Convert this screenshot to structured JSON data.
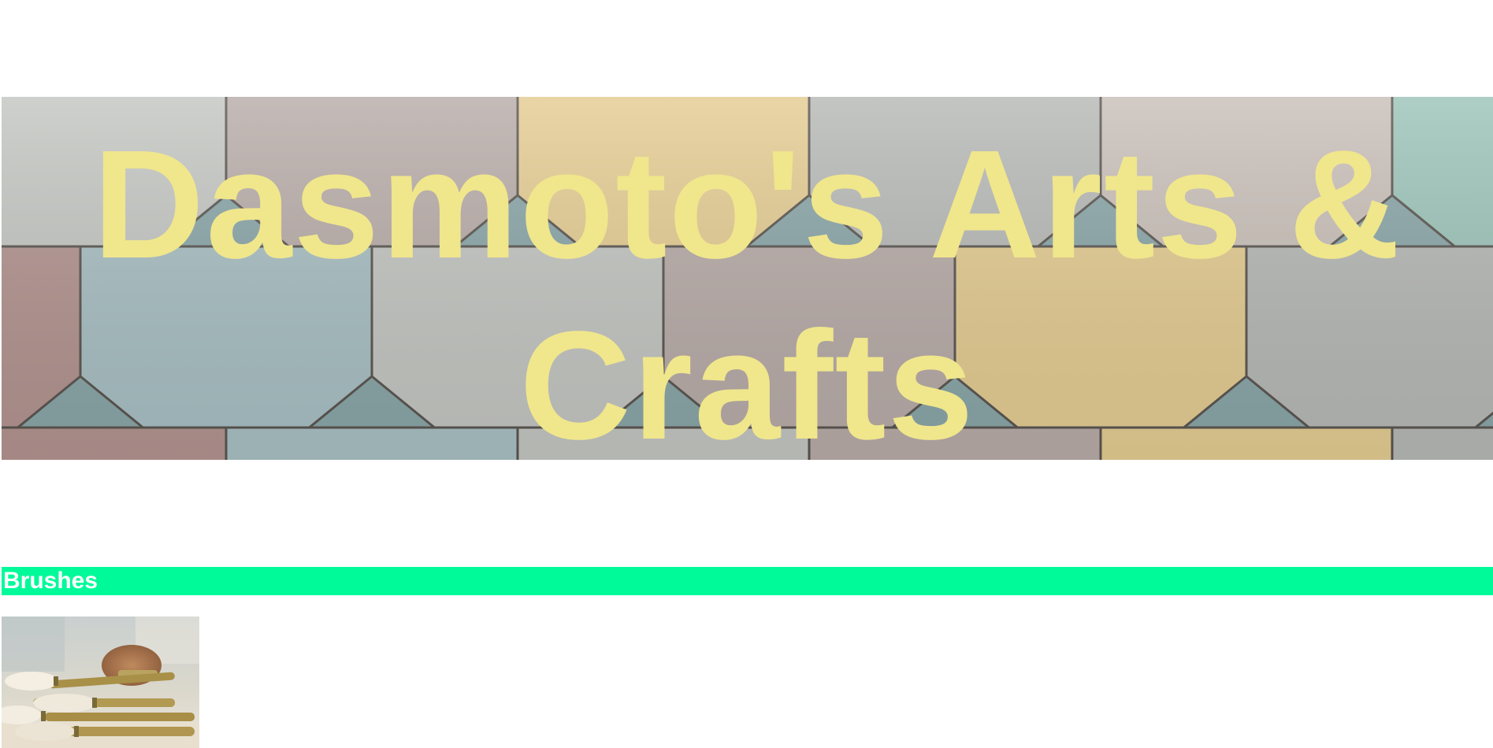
{
  "header": {
    "title": "Dasmoto's Arts & Crafts",
    "title_color": "#f0e68c",
    "background_image": "colorful-scale-tiles"
  },
  "sections": [
    {
      "heading": "Brushes",
      "heading_background": "#00fa9a",
      "heading_color": "#ffffff",
      "image": "paint-brushes-photo"
    }
  ]
}
